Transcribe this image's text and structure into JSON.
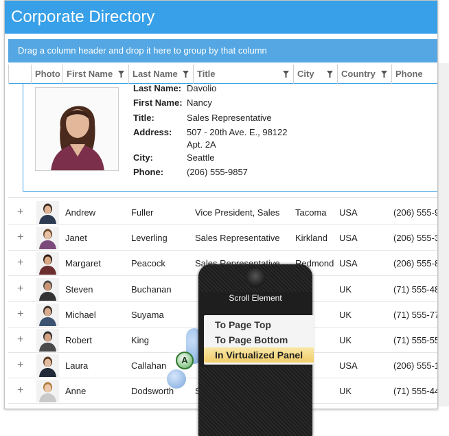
{
  "app": {
    "title": "Corporate Directory"
  },
  "group_bar": {
    "text": "Drag a column header and drop it here to group by that column"
  },
  "columns": {
    "photo": "Photo",
    "first_name": "First Name",
    "last_name": "Last Name",
    "title": "Title",
    "city": "City",
    "country": "Country",
    "phone": "Phone"
  },
  "detail": {
    "last_name_label": "Last Name:",
    "last_name": "Davolio",
    "first_name_label": "First Name:",
    "first_name": "Nancy",
    "title_label": "Title:",
    "title": "Sales Representative",
    "address_label": "Address:",
    "address_line1": "507 - 20th Ave. E., 98122",
    "address_line2": "Apt. 2A",
    "city_label": "City:",
    "city": "Seattle",
    "phone_label": "Phone:",
    "phone": "(206) 555-9857"
  },
  "rows": [
    {
      "first": "Andrew",
      "last": "Fuller",
      "title": "Vice President, Sales",
      "city": "Tacoma",
      "country": "USA",
      "phone": "(206) 555-9"
    },
    {
      "first": "Janet",
      "last": "Leverling",
      "title": "Sales Representative",
      "city": "Kirkland",
      "country": "USA",
      "phone": "(206) 555-3"
    },
    {
      "first": "Margaret",
      "last": "Peacock",
      "title": "Sales Representative",
      "city": "Redmond",
      "country": "USA",
      "phone": "(206) 555-8"
    },
    {
      "first": "Steven",
      "last": "Buchanan",
      "title": "",
      "city": "",
      "country": "UK",
      "phone": "(71) 555-48"
    },
    {
      "first": "Michael",
      "last": "Suyama",
      "title": "",
      "city": "don",
      "country": "UK",
      "phone": "(71) 555-77"
    },
    {
      "first": "Robert",
      "last": "King",
      "title": "",
      "city": "don",
      "country": "UK",
      "phone": "(71) 555-55"
    },
    {
      "first": "Laura",
      "last": "Callahan",
      "title": "",
      "city": "tle",
      "country": "USA",
      "phone": "(206) 555-1"
    },
    {
      "first": "Anne",
      "last": "Dodsworth",
      "title": "S",
      "city": "don",
      "country": "UK",
      "phone": "(71) 555-44"
    }
  ],
  "overlay": {
    "title": "Scroll Element",
    "items": [
      "To Page Top",
      "To Page Bottom",
      "In Virtualized Panel"
    ],
    "active_index": 2
  },
  "colors": {
    "accent": "#37a0e8",
    "group_bar": "#54a7e2",
    "menu_highlight": "#f2cd6a"
  },
  "icons": [
    "filter-icon",
    "expand-icon",
    "avatar"
  ]
}
